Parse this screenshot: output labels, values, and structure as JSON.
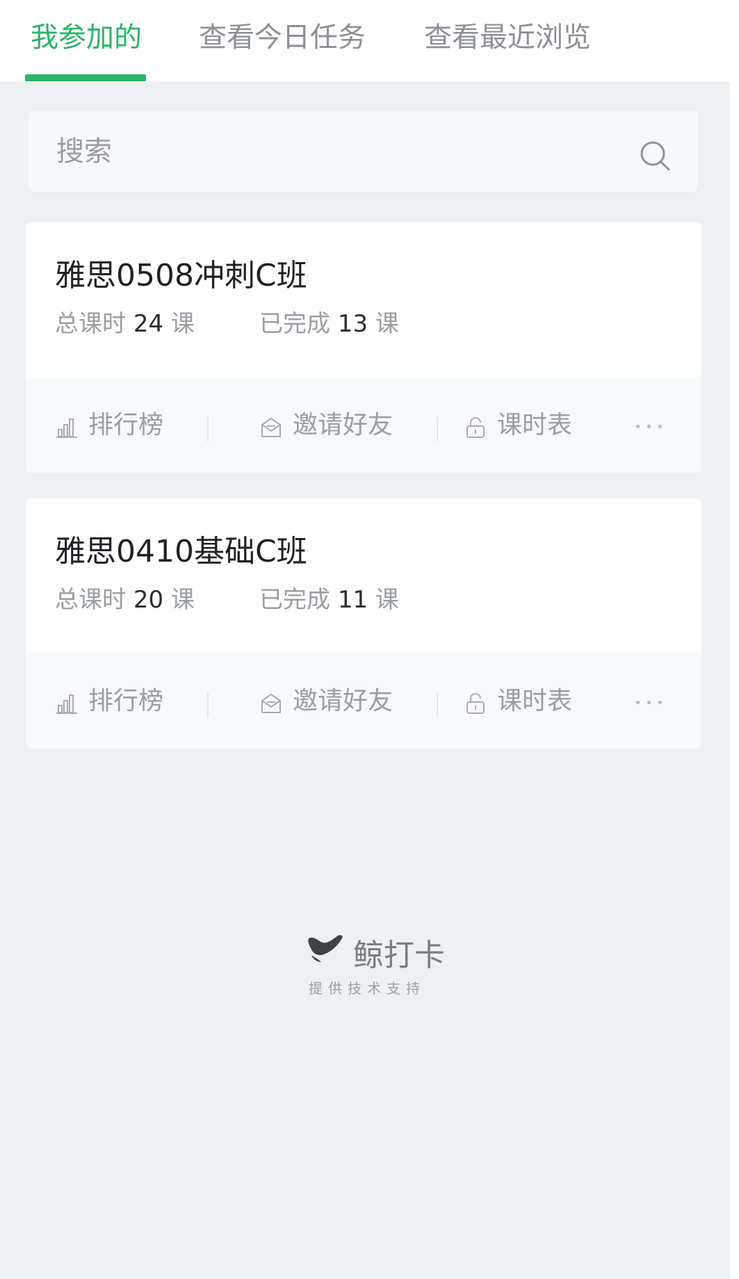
{
  "tabs": [
    {
      "label": "我参加的"
    },
    {
      "label": "查看今日任务"
    },
    {
      "label": "查看最近浏览"
    }
  ],
  "search": {
    "placeholder": "搜索"
  },
  "classes": [
    {
      "title": "雅思0508冲刺C班",
      "total_label": "总课时",
      "total_count": "24",
      "total_unit": "课",
      "done_label": "已完成",
      "done_count": "13",
      "done_unit": "课"
    },
    {
      "title": "雅思0410基础C班",
      "total_label": "总课时",
      "total_count": "20",
      "total_unit": "课",
      "done_label": "已完成",
      "done_count": "11",
      "done_unit": "课"
    }
  ],
  "actions": {
    "ranking": "排行榜",
    "invite": "邀请好友",
    "schedule": "课时表"
  },
  "icons": {
    "ranking": "bar-chart-icon",
    "invite": "envelope-icon",
    "schedule": "lock-icon",
    "more": "more-dots-icon",
    "search": "search-icon",
    "brand": "whale-logo-icon"
  },
  "footer": {
    "brand": "鲸打卡",
    "support": "提供技术支持"
  },
  "colors": {
    "accent": "#2bb36a",
    "background": "#eff0f2",
    "card": "#ffffff"
  }
}
